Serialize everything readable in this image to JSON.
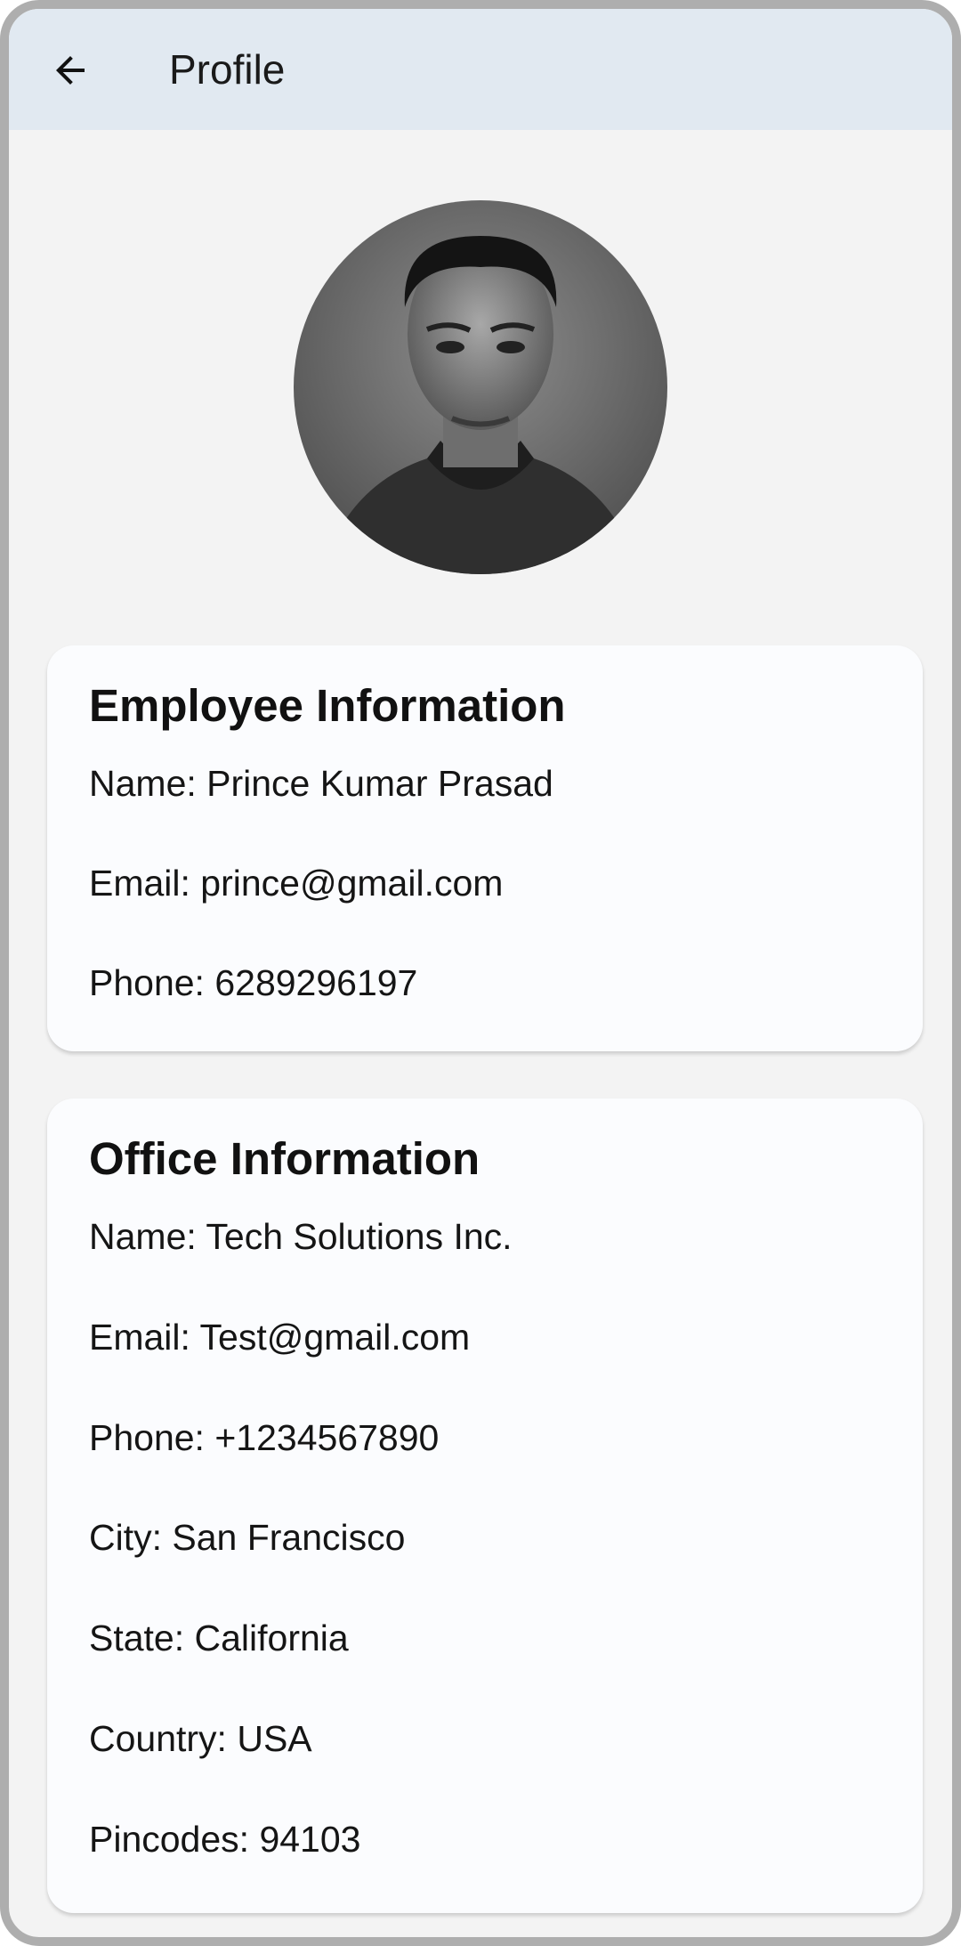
{
  "appbar": {
    "title": "Profile",
    "back_icon": "arrow-left-icon"
  },
  "avatar": {
    "icon": "profile-photo"
  },
  "employee": {
    "title": "Employee Information",
    "fields": [
      "Name: Prince Kumar Prasad",
      "Email: prince@gmail.com",
      "Phone: 6289296197"
    ]
  },
  "office": {
    "title": "Office Information",
    "fields": [
      "Name: Tech Solutions Inc.",
      "Email: Test@gmail.com",
      "Phone: +1234567890",
      "City: San Francisco",
      "State: California",
      "Country: USA",
      "Pincodes: 94103"
    ]
  },
  "colors": {
    "appbar_bg": "#e1e9f1",
    "page_bg": "#f3f3f3",
    "card_bg": "#fbfcfe",
    "frame": "#aeaeae"
  }
}
